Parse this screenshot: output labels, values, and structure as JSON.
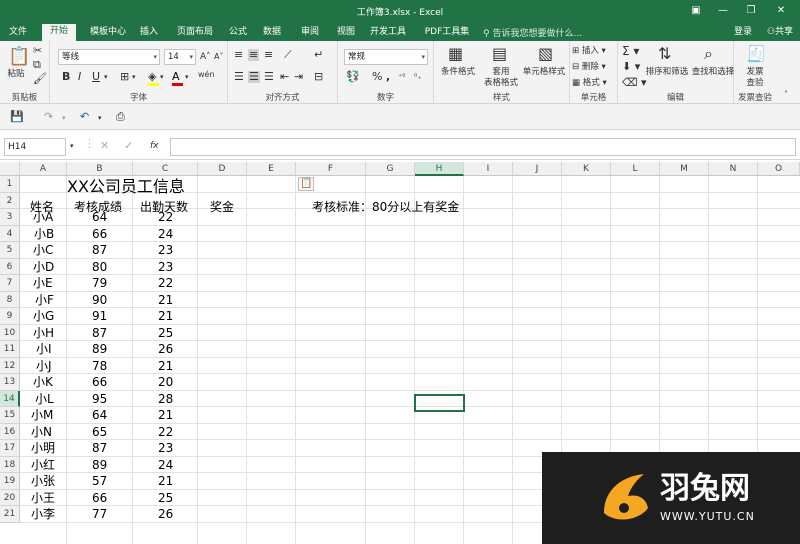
{
  "window": {
    "title": "工作簿3.xlsx - Excel",
    "min": "—",
    "restore": "❐",
    "close": "✕",
    "ribbon_toggle": "▣"
  },
  "menu": {
    "tabs": [
      "文件",
      "开始",
      "模板中心",
      "插入",
      "页面布局",
      "公式",
      "数据",
      "审阅",
      "视图",
      "开发工具",
      "PDF工具集"
    ],
    "active_index": 1,
    "tell_me": "告诉我您想要做什么...",
    "login": "登录",
    "share": "共享"
  },
  "ribbon": {
    "clipboard": {
      "label": "剪贴板",
      "paste": "粘贴"
    },
    "font": {
      "label": "字体",
      "name": "等线",
      "size": "14",
      "bold": "B",
      "italic": "I",
      "underline": "U",
      "wen": "wén"
    },
    "alignment": {
      "label": "对齐方式"
    },
    "number": {
      "label": "数字",
      "format": "常规",
      "percent": "%",
      "comma": ","
    },
    "styles": {
      "label": "样式",
      "conditional": "条件格式",
      "table_format": "套用\n表格格式",
      "cell_style": "单元格样式"
    },
    "cells": {
      "label": "单元格",
      "insert": "插入",
      "delete": "删除",
      "format": "格式"
    },
    "editing": {
      "label": "编辑",
      "sort_filter": "排序和筛选",
      "find_select": "查找和选择"
    },
    "invoice": {
      "label": "发票查验",
      "button": "发票\n查验"
    }
  },
  "formula_bar": {
    "name_box": "H14",
    "fx": "fx",
    "cancel": "✕",
    "confirm": "✓",
    "value": ""
  },
  "sheet": {
    "columns": [
      "A",
      "B",
      "C",
      "D",
      "E",
      "F",
      "G",
      "H",
      "I",
      "J",
      "K",
      "L",
      "M",
      "N",
      "O"
    ],
    "selected_col": "H",
    "rows": [
      "1",
      "2",
      "3",
      "4",
      "5",
      "6",
      "7",
      "8",
      "9",
      "10",
      "11",
      "12",
      "13",
      "14",
      "15",
      "16",
      "17",
      "18",
      "19",
      "20",
      "21"
    ],
    "selected_row": "14",
    "title": "XX公司员工信息",
    "headers": [
      "姓名",
      "考核成绩",
      "出勤天数",
      "奖金"
    ],
    "criteria": "考核标准：80分以上有奖金",
    "records": [
      [
        "小A",
        "64",
        "22"
      ],
      [
        "小B",
        "66",
        "24"
      ],
      [
        "小C",
        "87",
        "23"
      ],
      [
        "小D",
        "80",
        "23"
      ],
      [
        "小E",
        "79",
        "22"
      ],
      [
        "小F",
        "90",
        "21"
      ],
      [
        "小G",
        "91",
        "21"
      ],
      [
        "小H",
        "87",
        "25"
      ],
      [
        "小I",
        "89",
        "26"
      ],
      [
        "小J",
        "78",
        "21"
      ],
      [
        "小K",
        "66",
        "20"
      ],
      [
        "小L",
        "95",
        "28"
      ],
      [
        "小M",
        "64",
        "21"
      ],
      [
        "小N",
        "65",
        "22"
      ],
      [
        "小明",
        "87",
        "23"
      ],
      [
        "小红",
        "89",
        "24"
      ],
      [
        "小张",
        "57",
        "21"
      ],
      [
        "小王",
        "66",
        "25"
      ],
      [
        "小李",
        "77",
        "26"
      ]
    ]
  },
  "watermark": {
    "brand": "羽兔网",
    "url": "WWW.YUTU.CN"
  }
}
